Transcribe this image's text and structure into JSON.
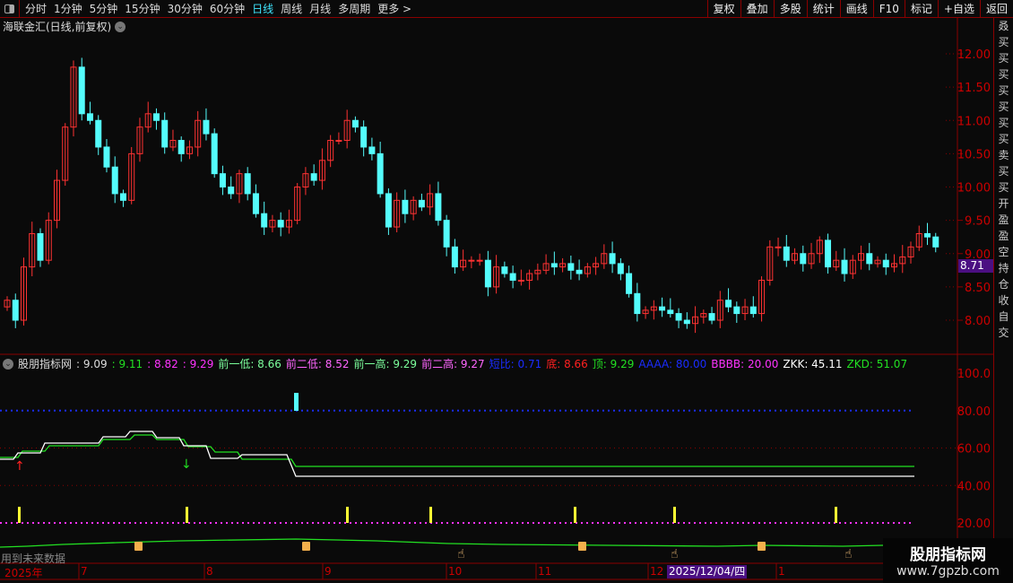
{
  "toolbar": {
    "periods": [
      "分时",
      "1分钟",
      "5分钟",
      "15分钟",
      "30分钟",
      "60分钟",
      "日线",
      "周线",
      "月线",
      "多周期",
      "更多 >"
    ],
    "active_period": "日线",
    "right_buttons": [
      "复权",
      "叠加",
      "多股",
      "统计",
      "画线",
      "F10",
      "标记",
      "+自选",
      "返回"
    ]
  },
  "chart": {
    "title": "海联金汇(日线,前复权)",
    "current_price": "8.71",
    "y_ticks": [
      "12.00",
      "11.50",
      "11.00",
      "10.50",
      "10.00",
      "9.50",
      "9.00",
      "8.50",
      "8.00"
    ],
    "first_open": 8.2,
    "closes": [
      8.3,
      8.0,
      8.8,
      9.3,
      8.9,
      9.5,
      10.1,
      10.9,
      11.8,
      11.1,
      11.0,
      10.6,
      10.3,
      9.9,
      9.8,
      10.5,
      10.9,
      11.1,
      11.0,
      10.6,
      10.7,
      10.5,
      10.6,
      11.0,
      10.8,
      10.2,
      10.0,
      9.9,
      10.2,
      9.9,
      9.6,
      9.4,
      9.5,
      9.4,
      9.5,
      10.0,
      10.2,
      10.1,
      10.4,
      10.7,
      10.7,
      11.0,
      10.9,
      10.6,
      10.5,
      9.9,
      9.4,
      9.8,
      9.6,
      9.8,
      9.7,
      9.9,
      9.5,
      9.1,
      8.8,
      8.9,
      8.9,
      8.9,
      8.5,
      8.8,
      8.7,
      8.6,
      8.6,
      8.7,
      8.75,
      8.85,
      8.8,
      8.85,
      8.75,
      8.7,
      8.8,
      8.85,
      9.0,
      8.85,
      8.7,
      8.4,
      8.1,
      8.15,
      8.2,
      8.15,
      8.1,
      8.0,
      7.95,
      8.05,
      8.1,
      8.0,
      8.3,
      8.2,
      8.1,
      8.2,
      8.1,
      8.6,
      9.1,
      9.1,
      8.9,
      9.0,
      8.85,
      9.0,
      9.2,
      8.8,
      8.9,
      8.7,
      8.9,
      9.0,
      8.85,
      8.9,
      8.8,
      8.85,
      8.95,
      9.1,
      9.3,
      9.25,
      9.1
    ],
    "up_color": "#ff3232",
    "down_color": "#54fcfc"
  },
  "indicator": {
    "name": "股朋指标网",
    "values": [
      {
        "label": "",
        "value": "9.09",
        "color": "#dddddd"
      },
      {
        "label": "",
        "value": "9.11",
        "color": "#22e022"
      },
      {
        "label": "",
        "value": "8.82",
        "color": "#ff33ff"
      },
      {
        "label": "",
        "value": "9.29",
        "color": "#ff33ff"
      },
      {
        "label": "前一低",
        "value": "8.66",
        "color": "#7cff9c"
      },
      {
        "label": "前二低",
        "value": "8.52",
        "color": "#ff66ff"
      },
      {
        "label": "前一高",
        "value": "9.29",
        "color": "#7cff9c"
      },
      {
        "label": "前二高",
        "value": "9.27",
        "color": "#ff66ff"
      },
      {
        "label": "短比",
        "value": "0.71",
        "color": "#1a2cff"
      },
      {
        "label": "底",
        "value": "8.66",
        "color": "#ff2020"
      },
      {
        "label": "顶",
        "value": "9.29",
        "color": "#22e022"
      },
      {
        "label": "AAAA",
        "value": "80.00",
        "color": "#1a2cff"
      },
      {
        "label": "BBBB",
        "value": "20.00",
        "color": "#ff33ff"
      },
      {
        "label": "ZKK",
        "value": "45.11",
        "color": "#ffffff"
      },
      {
        "label": "ZKD",
        "value": "51.07",
        "color": "#22e022"
      }
    ],
    "y_ticks": [
      "100.0",
      "80.00",
      "60.00",
      "40.00",
      "20.00"
    ],
    "future_note": "用到未来数据"
  },
  "time_axis": {
    "labels": [
      "2025年",
      "7",
      "8",
      "9",
      "10",
      "11",
      "12",
      "1"
    ],
    "cursor_date": "2025/12/04/四"
  },
  "watermark": {
    "title": "股朋指标网",
    "url": "www.7gpzb.com"
  }
}
